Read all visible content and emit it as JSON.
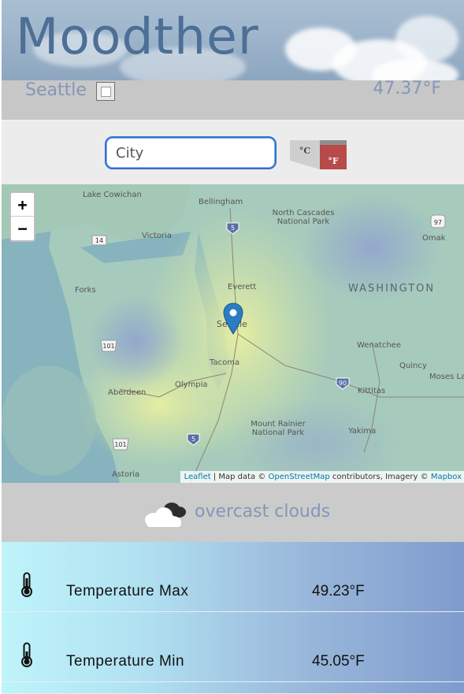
{
  "app": {
    "title": "Moodther"
  },
  "location": {
    "city": "Seattle",
    "current_temp": "47.37°F"
  },
  "search": {
    "placeholder": "City",
    "unit_c": "°C",
    "unit_f": "°F"
  },
  "map": {
    "zoom_in": "+",
    "zoom_out": "−",
    "labels": {
      "lake_cowichan": "Lake Cowichan",
      "bellingham": "Bellingham",
      "north_cascades": "North Cascades National Park",
      "victoria": "Victoria",
      "omak": "Omak",
      "forks": "Forks",
      "everett": "Everett",
      "washington": "WASHINGTON",
      "seattle": "Seattle",
      "wenatchee": "Wenatchee",
      "quincy": "Quincy",
      "moses_lake": "Moses La",
      "tacoma": "Tacoma",
      "aberdeen": "Aberdeen",
      "olympia": "Olympia",
      "kittitas": "Kittitas",
      "mount_rainier": "Mount Rainier National Park",
      "yakima": "Yakima",
      "astoria": "Astoria"
    },
    "shields": {
      "i5_north": "5",
      "hwy97": "97",
      "hwy14": "14",
      "hwy101_a": "101",
      "i90": "90",
      "i5_south": "5",
      "hwy101_b": "101"
    },
    "attribution": {
      "leaflet": "Leaflet",
      "map_data": " | Map data © ",
      "osm": "OpenStreetMap",
      "contrib": " contributors, Imagery © ",
      "mapbox": "Mapbox"
    }
  },
  "weather": {
    "description": "overcast clouds"
  },
  "stats": [
    {
      "label": "Temperature Max",
      "value": "49.23°F"
    },
    {
      "label": "Temperature Min",
      "value": "45.05°F"
    }
  ],
  "colors": {
    "accent": "#8497b8",
    "header_text": "#4d6f96",
    "input_border": "#2e6fd3",
    "fahrenheit_active": "#b94a4a"
  }
}
